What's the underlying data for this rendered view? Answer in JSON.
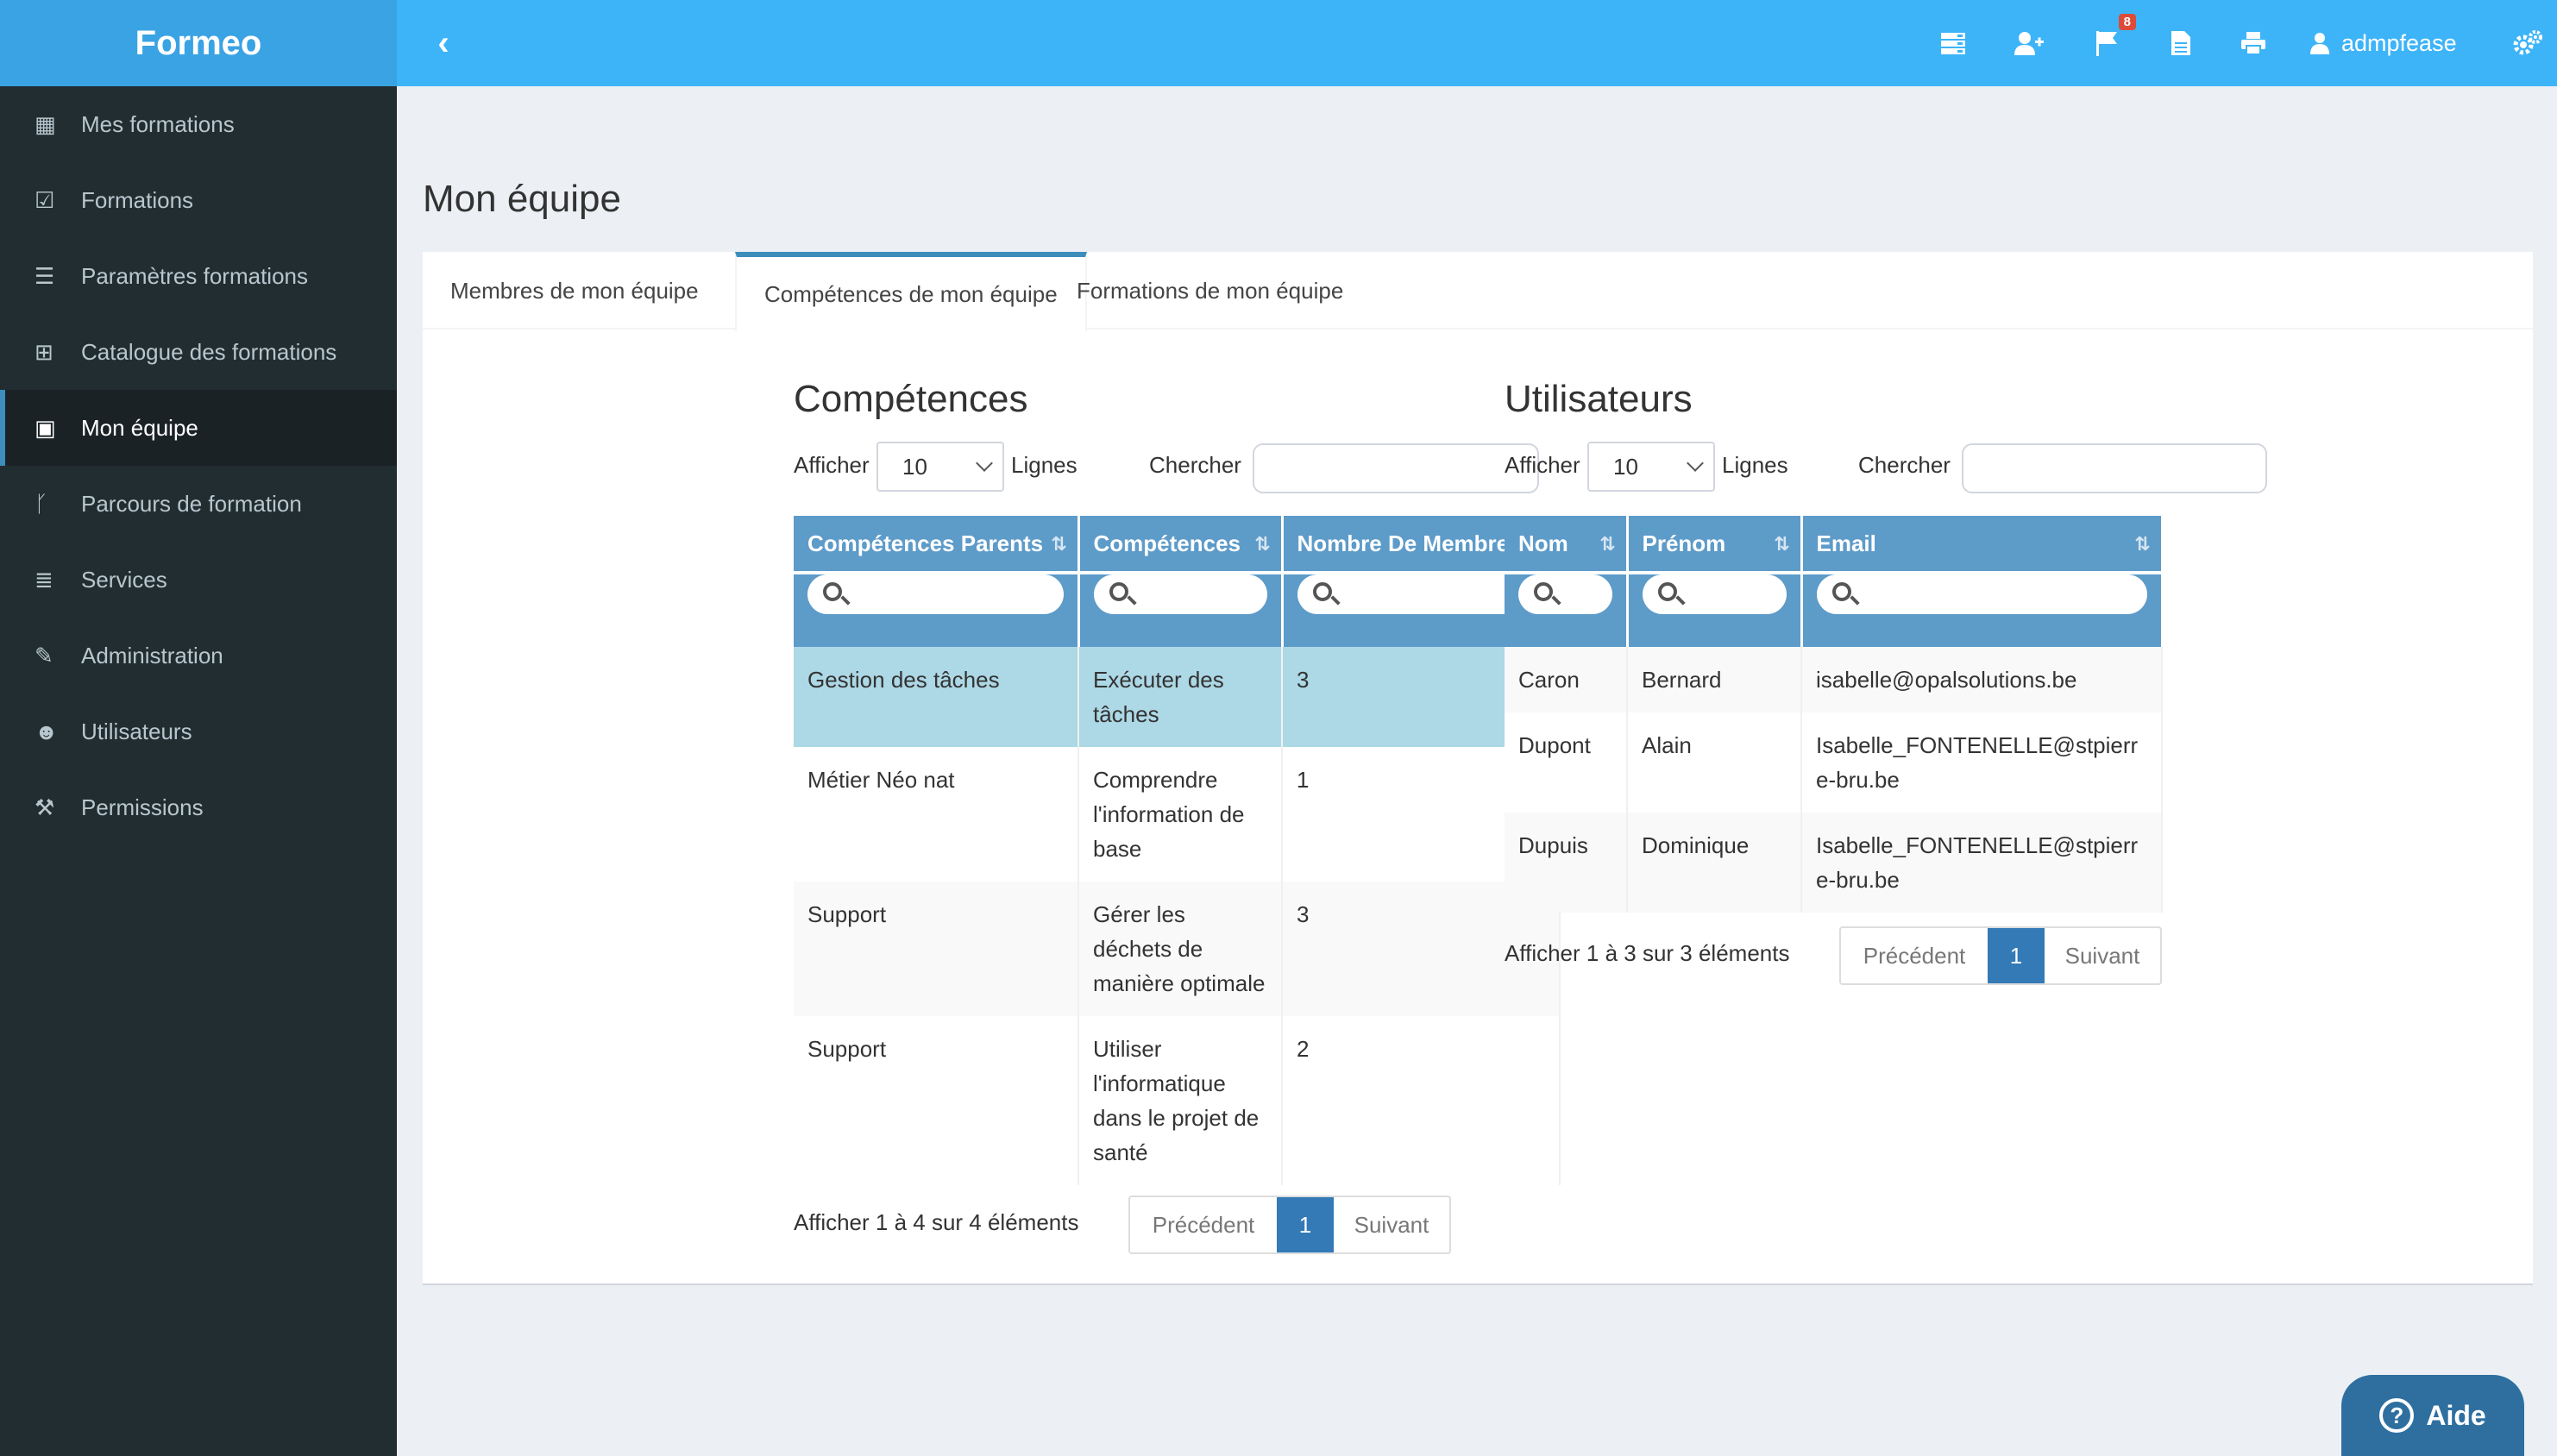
{
  "app": {
    "brand": "Formeo"
  },
  "sidebar": {
    "items": [
      {
        "label": "Mes formations",
        "icon": "calendar-icon"
      },
      {
        "label": "Formations",
        "icon": "calendar-check-icon"
      },
      {
        "label": "Paramètres formations",
        "icon": "sliders-icon"
      },
      {
        "label": "Catalogue des formations",
        "icon": "calendar-plus-icon"
      },
      {
        "label": "Mon équipe",
        "icon": "id-badge-icon",
        "active": true
      },
      {
        "label": "Parcours de formation",
        "icon": "code-fork-icon"
      },
      {
        "label": "Services",
        "icon": "list-icon"
      },
      {
        "label": "Administration",
        "icon": "wrench-icon"
      },
      {
        "label": "Utilisateurs",
        "icon": "users-icon"
      },
      {
        "label": "Permissions",
        "icon": "gavel-icon"
      }
    ]
  },
  "topbar": {
    "notifications_count": "8",
    "username": "admpfease"
  },
  "page": {
    "title": "Mon équipe",
    "tabs": [
      {
        "label": "Membres de mon équipe"
      },
      {
        "label": "Compétences de mon équipe",
        "active": true
      },
      {
        "label": "Formations de mon équipe"
      }
    ]
  },
  "competences": {
    "title": "Compétences",
    "show_label": "Afficher",
    "page_size": "10",
    "lines_label": "Lignes",
    "search_label": "Chercher",
    "columns": [
      "Compétences Parents",
      "Compétences",
      "Nombre De Membres"
    ],
    "rows": [
      {
        "parent": "Gestion des tâches",
        "competence": "Exécuter des tâches",
        "count": "3"
      },
      {
        "parent": "Métier Néo nat",
        "competence": "Comprendre l'information de base",
        "count": "1"
      },
      {
        "parent": "Support",
        "competence": "Gérer les déchets de manière optimale",
        "count": "3"
      },
      {
        "parent": "Support",
        "competence": "Utiliser l'informatique dans le projet de santé",
        "count": "2"
      }
    ],
    "info": "Afficher 1 à 4 sur 4 éléments",
    "pager": {
      "prev": "Précédent",
      "current": "1",
      "next": "Suivant"
    }
  },
  "utilisateurs": {
    "title": "Utilisateurs",
    "show_label": "Afficher",
    "page_size": "10",
    "lines_label": "Lignes",
    "search_label": "Chercher",
    "columns": [
      "Nom",
      "Prénom",
      "Email"
    ],
    "rows": [
      {
        "nom": "Caron",
        "prenom": "Bernard",
        "email": "isabelle@opalsolutions.be"
      },
      {
        "nom": "Dupont",
        "prenom": "Alain",
        "email": "Isabelle_FONTENELLE@stpierre-bru.be"
      },
      {
        "nom": "Dupuis",
        "prenom": "Dominique",
        "email": "Isabelle_FONTENELLE@stpierre-bru.be"
      }
    ],
    "info": "Afficher 1 à 3 sur 3 éléments",
    "pager": {
      "prev": "Précédent",
      "current": "1",
      "next": "Suivant"
    }
  },
  "help": {
    "label": "Aide"
  }
}
